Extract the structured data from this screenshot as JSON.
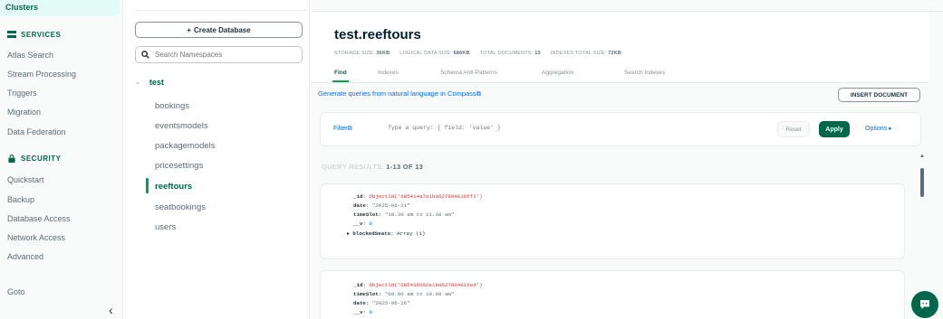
{
  "leftnav": {
    "top_item": "Clusters",
    "services_label": "SERVICES",
    "services_items": [
      "Atlas Search",
      "Stream Processing",
      "Triggers",
      "Migration",
      "Data Federation"
    ],
    "security_label": "SECURITY",
    "security_items": [
      "Quickstart",
      "Backup",
      "Database Access",
      "Network Access",
      "Advanced"
    ],
    "bottom_item": "Goto",
    "collapse_glyph": "‹"
  },
  "namespaces": {
    "create_label": "Create Database",
    "search_placeholder": "Search Namespaces",
    "database": "test",
    "collections": [
      "bookings",
      "eventsmodels",
      "packagemodels",
      "pricesettings",
      "reeftours",
      "seatbookings",
      "users"
    ],
    "active_collection": "reeftours"
  },
  "header": {
    "title": "test.reeftours",
    "stats": [
      {
        "label": "STORAGE SIZE:",
        "value": "36KB"
      },
      {
        "label": "LOGICAL DATA SIZE:",
        "value": "686KB"
      },
      {
        "label": "TOTAL DOCUMENTS:",
        "value": "13"
      },
      {
        "label": "INDEXES TOTAL SIZE:",
        "value": "72KB"
      }
    ],
    "tabs": [
      "Find",
      "Indexes",
      "Schema Anti-Patterns",
      "Aggregation",
      "Search Indexes"
    ],
    "active_tab": "Find"
  },
  "toolbar": {
    "nl_link": "Generate queries from natural language in Compass",
    "insert_label": "INSERT DOCUMENT"
  },
  "query": {
    "filter_label": "Filter",
    "filter_placeholder": "Type a query: { field: 'value' }",
    "reset_label": "Reset",
    "apply_label": "Apply",
    "options_label": "Options"
  },
  "results": {
    "label_prefix": "QUERY RESULTS:",
    "range": "1-13 OF 13"
  },
  "documents": [
    {
      "lines": [
        {
          "key": "_id",
          "value": "ObjectId('685414a7e1b0627804816ff2')",
          "type": "oid"
        },
        {
          "key": "date",
          "value": "\"2025-06-21\"",
          "type": "str"
        },
        {
          "key": "timeSlot",
          "value": "\"10.30 am to 11.30 am\"",
          "type": "str"
        },
        {
          "key": "__v",
          "value": "0",
          "type": "num"
        },
        {
          "key": "blockedSeats",
          "value": "Array (1)",
          "type": "arr"
        }
      ]
    },
    {
      "lines": [
        {
          "key": "_id",
          "value": "ObjectId('685436602e1b0627804816ed')",
          "type": "oid"
        },
        {
          "key": "timeSlot",
          "value": "\"09.00 am to 10.00 am\"",
          "type": "str"
        },
        {
          "key": "date",
          "value": "\"2025-06-26\"",
          "type": "str"
        },
        {
          "key": "__v",
          "value": "0",
          "type": "num"
        }
      ]
    }
  ],
  "colors": {
    "accent": "#00684a",
    "link": "#016bf8",
    "oid": "#db3030"
  }
}
